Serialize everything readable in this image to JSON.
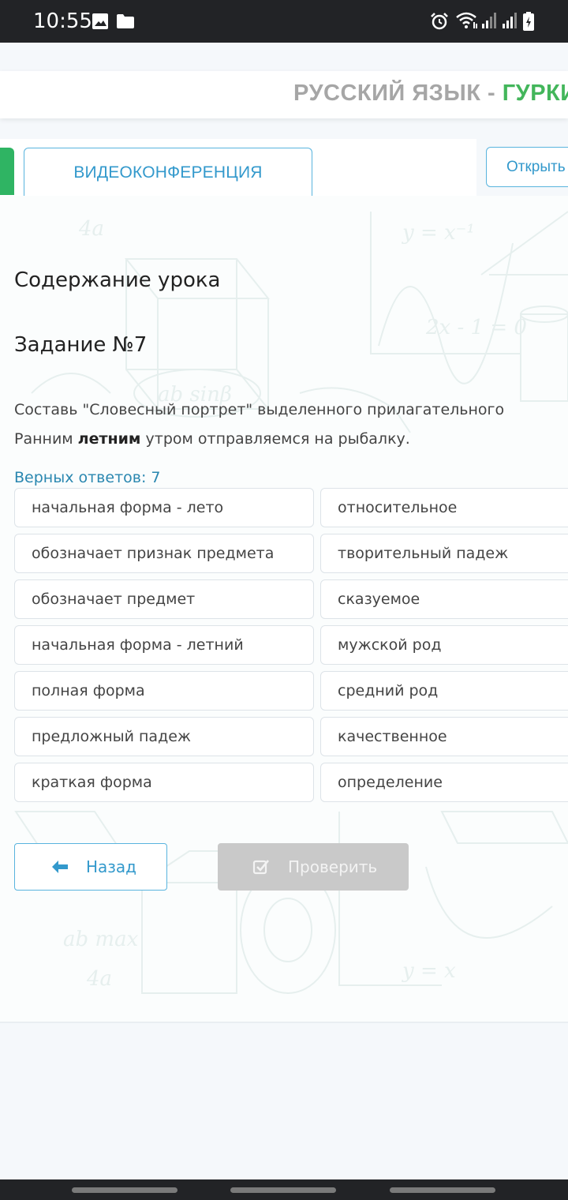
{
  "status_bar": {
    "time": "10:55"
  },
  "header": {
    "course_prefix": "РУССКИЙ ЯЗЫК - ",
    "course_teacher": "ГУРКИ"
  },
  "tabs": {
    "video_conference": "ВИДЕОКОНФЕРЕНЦИЯ",
    "open_button": "Открыть"
  },
  "lesson": {
    "title": "Содержание урока",
    "task_title": "Задание №7",
    "instruction": "Составь \"Словесный портрет\" выделенного прилагательного",
    "sentence_before": "Ранним ",
    "sentence_bold": "летним",
    "sentence_after": " утром отправляемся на рыбалку.",
    "answers_count": "Верных ответов: 7"
  },
  "options_left": [
    "начальная форма - лето",
    "обозначает признак предмета",
    "обозначает предмет",
    "начальная форма - летний",
    "полная форма",
    "предложный падеж",
    "краткая форма"
  ],
  "options_right": [
    "относительное",
    "творительный падеж",
    "сказуемое",
    "мужской род",
    "средний род",
    "качественное",
    "определение"
  ],
  "buttons": {
    "back": "Назад",
    "check": "Проверить"
  },
  "colors": {
    "accent_blue": "#3399cc",
    "accent_green": "#43b65b",
    "disabled_gray": "#c9c9c9"
  }
}
